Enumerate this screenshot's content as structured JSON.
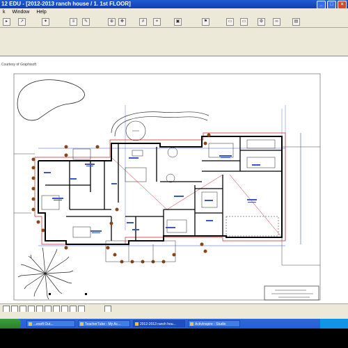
{
  "window": {
    "title": "12 EDU - [2012-2013 ranch house / 1. 1st FLOOR]"
  },
  "menubar": {
    "items": [
      "k",
      "Window",
      "Help"
    ]
  },
  "toolbar": {
    "buttons": [
      "pointer-icon",
      "arrow-icon",
      "magic-wand-icon",
      "layer-icon",
      "pen-icon",
      "zoom-icon",
      "pan-icon",
      "grid-icon",
      "snap-icon",
      "view-icon"
    ]
  },
  "drawing": {
    "courtesy": "Courtesy of Graphisoft"
  },
  "taskbar": {
    "items": [
      "...esoft Out...",
      "TeacherTube - My Ac...",
      "2012-2013 ranch hou...",
      "ActivInspire - Studio"
    ]
  },
  "colors": {
    "titlebar": "#1f5bd6",
    "wall": "#000000",
    "dimension": "#3a55c8",
    "outline_red": "#cc2222",
    "tree": "#8b4513"
  }
}
